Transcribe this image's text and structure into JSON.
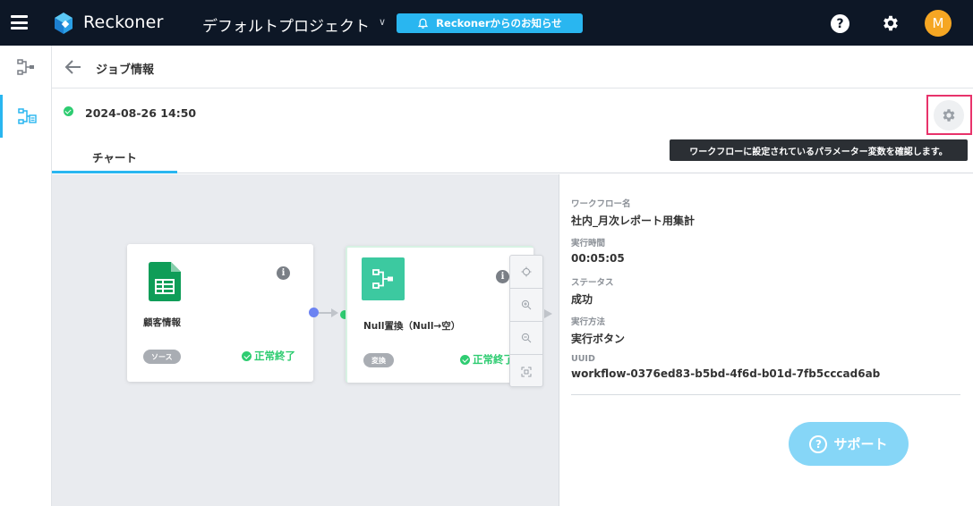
{
  "header": {
    "app_name": "Reckoner",
    "project_name": "デフォルトプロジェクト",
    "notice_label": "Reckonerからのお知らせ",
    "help_symbol": "?",
    "avatar_initial": "M"
  },
  "job": {
    "title": "ジョブ情報",
    "run_datetime": "2024-08-26 14:50",
    "status_color": "#2ecc71",
    "settings_tooltip": "ワークフローに設定されているパラメーター変数を確認します。"
  },
  "tabs": [
    {
      "label": "チャート",
      "active": true
    }
  ],
  "nodes": [
    {
      "label": "顧客情報",
      "tag": "ソース",
      "status": "正常終了",
      "icon": "google-sheets-icon"
    },
    {
      "label": "Null置換（Null→空）",
      "tag": "変換",
      "status": "正常終了",
      "icon": "transform-icon"
    }
  ],
  "details": {
    "workflow_name_label": "ワークフロー名",
    "workflow_name": "社内_月次レポート用集計",
    "exec_time_label": "実行時間",
    "exec_time": "00:05:05",
    "status_label": "ステータス",
    "status": "成功",
    "method_label": "実行方法",
    "method": "実行ボタン",
    "uuid_label": "UUID",
    "uuid": "workflow-0376ed83-b5bd-4f6d-b01d-7fb5cccad6ab"
  },
  "support": {
    "label": "サポート",
    "symbol": "?"
  },
  "colors": {
    "topbar": "#0d1726",
    "accent": "#29b6f0",
    "success": "#2ecc71",
    "highlight": "#e8336b"
  }
}
